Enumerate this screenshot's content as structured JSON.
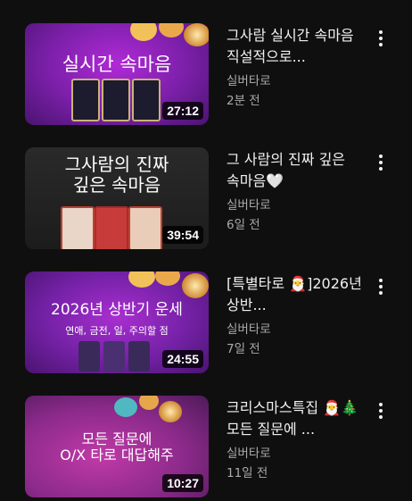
{
  "videos": [
    {
      "thumb_title": "실시간 속마음",
      "thumb_subtitle": "",
      "duration": "27:12",
      "title": "그사람 실시간 속마음 직설적으로...",
      "channel": "실버타로",
      "age": "2분 전"
    },
    {
      "thumb_title": "그사람의 진짜\n깊은 속마음",
      "thumb_subtitle": "",
      "duration": "39:54",
      "title": "그 사람의 진짜 깊은 속마음🤍",
      "channel": "실버타로",
      "age": "6일 전"
    },
    {
      "thumb_title": "2026년 상반기 운세",
      "thumb_subtitle": "연애, 금전, 일, 주의할 점",
      "duration": "24:55",
      "title": "[특별타로 🎅]2026년 상반...",
      "channel": "실버타로",
      "age": "7일 전"
    },
    {
      "thumb_title": "모든 질문에\nO/X 타로 대답해주",
      "thumb_subtitle": "",
      "duration": "10:27",
      "title": "크리스마스특집 🎅🎄모든 질문에 ...",
      "channel": "실버타로",
      "age": "11일 전"
    }
  ]
}
